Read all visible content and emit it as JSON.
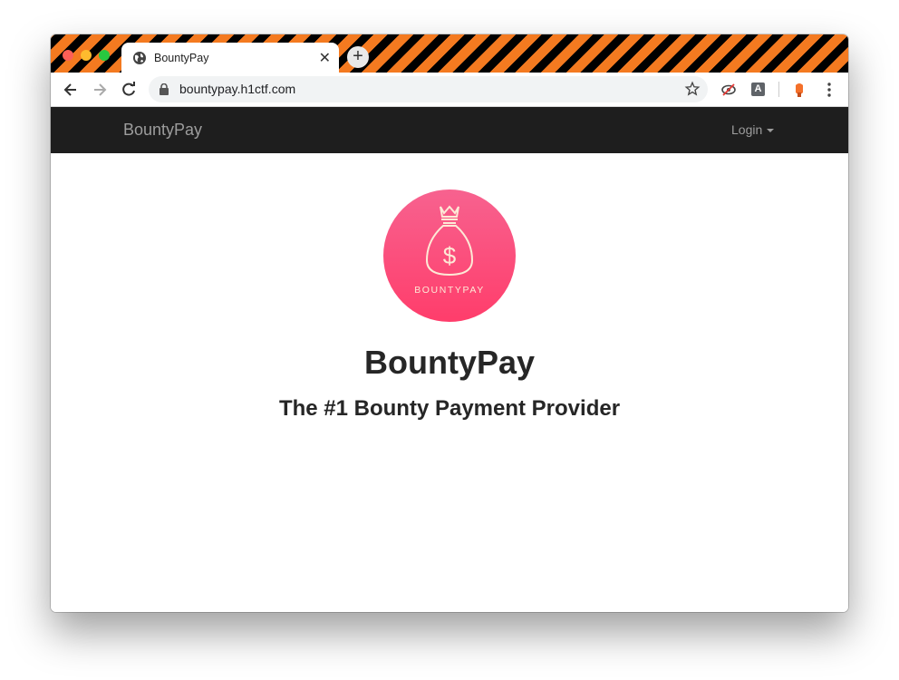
{
  "browser": {
    "tab_title": "BountyPay",
    "tab_close": "✕",
    "new_tab": "+",
    "url": "bountypay.h1ctf.com",
    "extension_a": "A"
  },
  "navbar": {
    "brand": "BountyPay",
    "login": "Login"
  },
  "hero": {
    "logo_text": "BOUNTYPAY",
    "logo_symbol": "$",
    "title": "BountyPay",
    "subtitle": "The #1 Bounty Payment Provider"
  },
  "colors": {
    "navbar_bg": "#1e1e1e",
    "logo_gradient_top": "#f7628f",
    "logo_gradient_bottom": "#ff3d6b",
    "stripe_orange": "#f47a20"
  },
  "icons": [
    "globe-icon",
    "close-icon",
    "back-icon",
    "forward-icon",
    "reload-icon",
    "lock-icon",
    "star-icon",
    "eye-off-icon",
    "extension-a-icon",
    "profile-icon",
    "menu-icon",
    "money-bag-icon"
  ]
}
